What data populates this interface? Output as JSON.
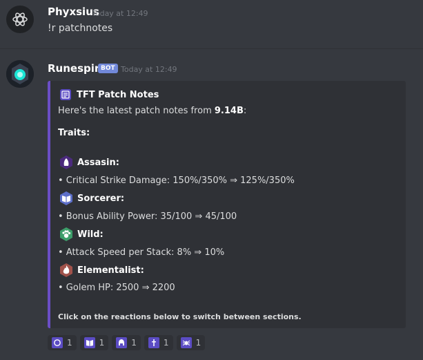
{
  "messages": [
    {
      "author": "Phyxsius",
      "timestamp": "Today at 12:49",
      "text": "!r patchnotes"
    },
    {
      "author": "Runespirit",
      "bot_tag": "BOT",
      "timestamp": "Today at 12:49"
    }
  ],
  "embed": {
    "accent_color": "#6b4ec6",
    "title": "TFT Patch Notes",
    "intro_prefix": "Here's the latest patch notes from ",
    "version": "9.14B",
    "intro_suffix": ":",
    "section_heading": "Traits:",
    "traits": [
      {
        "name": "Assasin:",
        "icon": "assassin-icon",
        "color": "#4b2a7d",
        "change": "• Critical Strike Damage: 150%/350% ⇒ 125%/350%"
      },
      {
        "name": "Sorcerer:",
        "icon": "sorcerer-icon",
        "color": "#5d6fc9",
        "change": "• Bonus Ability Power: 35/100 ⇒ 45/100"
      },
      {
        "name": "Wild:",
        "icon": "wild-icon",
        "color": "#3d9e6a",
        "change": "• Attack Speed per Stack: 8% ⇒ 10%"
      },
      {
        "name": "Elementalist:",
        "icon": "elementalist-icon",
        "color": "#a0524b",
        "change": "• Golem HP: 2500 ⇒ 2200"
      }
    ],
    "footer": "Click on the reactions below to switch between sections."
  },
  "reactions": [
    {
      "icon": "circle-icon",
      "count": "1"
    },
    {
      "icon": "book-icon",
      "count": "1"
    },
    {
      "icon": "helmet-icon",
      "count": "1"
    },
    {
      "icon": "dagger-icon",
      "count": "1"
    },
    {
      "icon": "spider-icon",
      "count": "1"
    }
  ]
}
